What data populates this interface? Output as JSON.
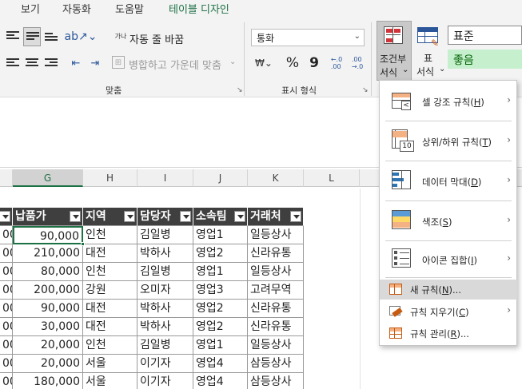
{
  "ribbon_tabs": [
    {
      "label": "보기"
    },
    {
      "label": "자동화"
    },
    {
      "label": "도움말"
    },
    {
      "label": "테이블 디자인"
    }
  ],
  "alignment": {
    "wrap_text_label": "자동 줄 바꿈",
    "merge_center_label": "병합하고 가운데 맞춤",
    "group_label": "맞춤",
    "orientation_icon": "text-orientation-icon",
    "wrap_prefix": "가나"
  },
  "number_format": {
    "value": "통화",
    "group_label": "표시 형식",
    "percent": "%",
    "comma": "9",
    "increase_decimal": "←.0\n.00",
    "decrease_decimal": ".00\n→.0"
  },
  "styles": {
    "conditional_label_1": "조건부",
    "conditional_label_2": "서식",
    "table_label_1": "표",
    "table_label_2": "서식",
    "cell_style_normal": "표준",
    "cell_style_good": "좋음",
    "good_fill": "#c6efce",
    "good_text": "#006100"
  },
  "columns": [
    "G",
    "H",
    "I",
    "J",
    "K",
    "L"
  ],
  "table": {
    "headers": [
      "납품가",
      "지역",
      "담당자",
      "소속팀",
      "거래처"
    ],
    "partial_col_values": [
      "00",
      "00",
      "00",
      "00",
      "00",
      "00",
      "00",
      "00",
      "00"
    ],
    "rows": [
      {
        "price": "90,000",
        "region": "인천",
        "manager": "김일병",
        "team": "영업1",
        "client": "일등상사"
      },
      {
        "price": "210,000",
        "region": "대전",
        "manager": "박하사",
        "team": "영업2",
        "client": "신라유통"
      },
      {
        "price": "80,000",
        "region": "인천",
        "manager": "김일병",
        "team": "영업1",
        "client": "일등상사"
      },
      {
        "price": "200,000",
        "region": "강원",
        "manager": "오미자",
        "team": "영업3",
        "client": "고려무역"
      },
      {
        "price": "90,000",
        "region": "대전",
        "manager": "박하사",
        "team": "영업2",
        "client": "신라유통"
      },
      {
        "price": "30,000",
        "region": "대전",
        "manager": "박하사",
        "team": "영업2",
        "client": "신라유통"
      },
      {
        "price": "20,000",
        "region": "인천",
        "manager": "김일병",
        "team": "영업1",
        "client": "일등상사"
      },
      {
        "price": "20,000",
        "region": "서울",
        "manager": "이기자",
        "team": "영업4",
        "client": "삼등상사"
      },
      {
        "price": "180,000",
        "region": "서울",
        "manager": "이기자",
        "team": "영업4",
        "client": "삼등상사"
      }
    ]
  },
  "conditional_menu": {
    "items": [
      {
        "label": "셀 강조 규칙",
        "key": "H",
        "icon": "highlight-cells-rules-icon",
        "submenu": true
      },
      {
        "label": "상위/하위 규칙",
        "key": "T",
        "icon": "top-bottom-rules-icon",
        "submenu": true
      },
      {
        "label": "데이터 막대",
        "key": "D",
        "icon": "data-bars-icon",
        "submenu": true
      },
      {
        "label": "색조",
        "key": "S",
        "icon": "color-scales-icon",
        "submenu": true
      },
      {
        "label": "아이콘 집합",
        "key": "I",
        "icon": "icon-sets-icon",
        "submenu": true
      }
    ],
    "new_rule": {
      "label": "새 규칙",
      "key": "N",
      "suffix": "..."
    },
    "clear_rules": {
      "label": "규칙 지우기",
      "key": "C"
    },
    "manage_rules": {
      "label": "규칙 관리",
      "key": "R",
      "suffix": "..."
    },
    "top_bottom_icon_text": "10"
  },
  "colors": {
    "accent": "#1e7145",
    "header_fill": "#3f3f3f",
    "menu_highlight": "#d9d9d9"
  }
}
